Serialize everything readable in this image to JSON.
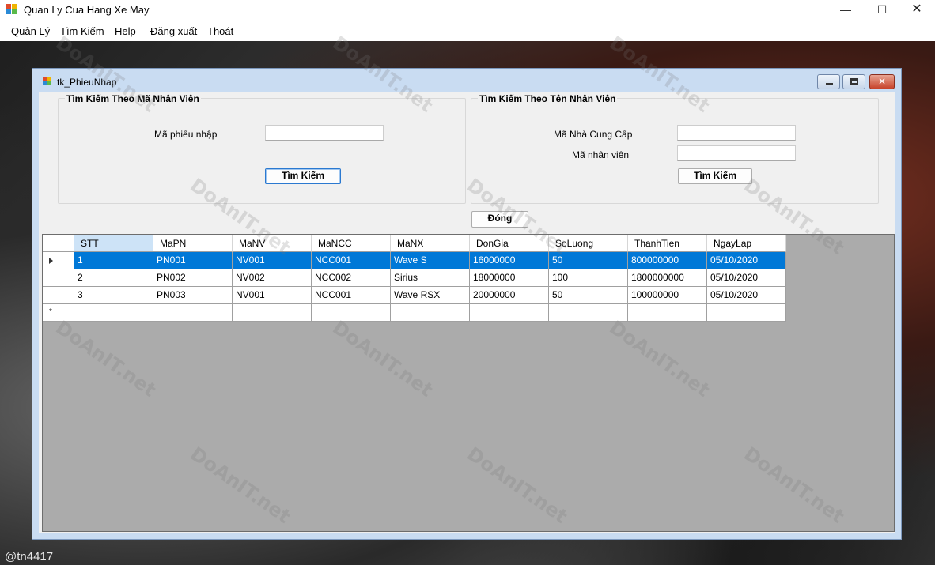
{
  "app": {
    "title": "Quan Ly Cua Hang Xe May",
    "min": "—",
    "max": "☐",
    "close": "✕"
  },
  "menu": [
    "Quản Lý",
    "Tìm Kiếm",
    "Help",
    "Đăng xuất",
    "Thoát"
  ],
  "child": {
    "title": "tk_PhieuNhap"
  },
  "group_left": {
    "title": "Tìm Kiếm Theo Mã Nhân Viên",
    "label_mapn": "Mã phiếu nhập",
    "mapn_value": "",
    "search_button": "Tìm Kiếm"
  },
  "group_right": {
    "title": "Tìm Kiếm Theo Tên Nhân Viên",
    "label_mancc": "Mã Nhà Cung Cấp",
    "mancc_value": "",
    "label_manv": "Mã nhân viên",
    "manv_value": "",
    "search_button": "Tìm Kiếm"
  },
  "close_button": "Đóng",
  "grid": {
    "columns": [
      "STT",
      "MaPN",
      "MaNV",
      "MaNCC",
      "MaNX",
      "DonGia",
      "SoLuong",
      "ThanhTien",
      "NgayLap"
    ],
    "rows": [
      [
        "1",
        "PN001",
        "NV001",
        "NCC001",
        "Wave S",
        "16000000",
        "50",
        "800000000",
        "05/10/2020"
      ],
      [
        "2",
        "PN002",
        "NV002",
        "NCC002",
        "Sirius",
        "18000000",
        "100",
        "1800000000",
        "05/10/2020"
      ],
      [
        "3",
        "PN003",
        "NV001",
        "NCC001",
        "Wave RSX",
        "20000000",
        "50",
        "100000000",
        "05/10/2020"
      ]
    ],
    "new_row_marker": "*"
  },
  "watermark": "DoAnIT.net",
  "handle": "@tn4417",
  "colors": {
    "selection": "#0078d7",
    "grid_bg": "#ababab"
  }
}
